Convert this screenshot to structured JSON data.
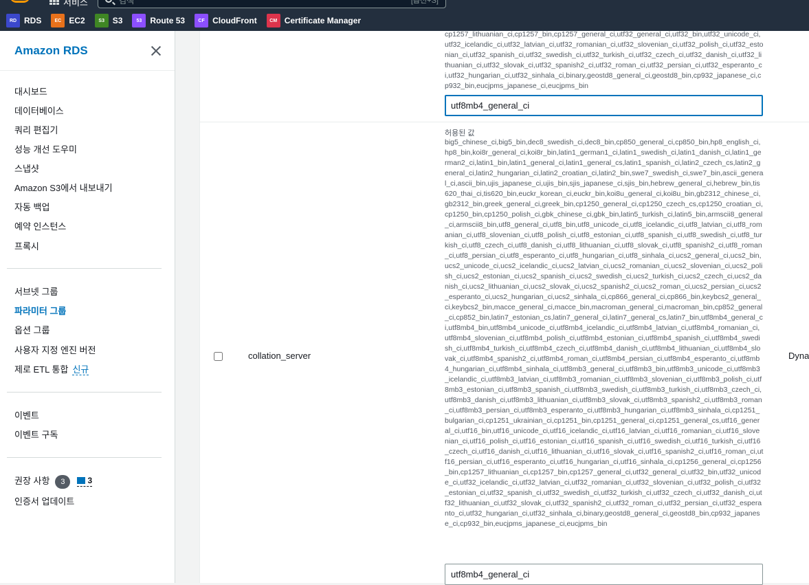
{
  "topbar": {
    "services_fragment": "서비스",
    "search": {
      "placeholder": "검색",
      "shortcut_hint": "[옵션+S]"
    },
    "favorites": [
      {
        "label": "RDS",
        "icon": "rds-icon",
        "color": "#3b48cc"
      },
      {
        "label": "EC2",
        "icon": "ec2-icon",
        "color": "#e7711b"
      },
      {
        "label": "S3",
        "icon": "s3-icon",
        "color": "#3f8624"
      },
      {
        "label": "Route 53",
        "icon": "route53-icon",
        "color": "#8c4fff"
      },
      {
        "label": "CloudFront",
        "icon": "cloudfront-icon",
        "color": "#8c4fff"
      },
      {
        "label": "Certificate Manager",
        "icon": "certificate-manager-icon",
        "color": "#dd344c"
      }
    ]
  },
  "sidebar": {
    "title": "Amazon RDS",
    "group1": [
      "대시보드",
      "데이터베이스",
      "쿼리 편집기",
      "성능 개선 도우미",
      "스냅샷",
      "Amazon S3에서 내보내기",
      "자동 백업",
      "예약 인스턴스",
      "프록시"
    ],
    "group2": [
      "서브넷 그룹",
      "파라미터 그룹",
      "옵션 그룹",
      "사용자 지정 엔진 버전"
    ],
    "zero_etl_label": "제로 ETL 통합",
    "zero_etl_badge": "신규",
    "group3": [
      "이벤트",
      "이벤트 구독"
    ],
    "recommendations_label": "권장 사항",
    "recommendations_count": "3",
    "recommendations_info_count": "3",
    "cert_update_label": "인증서 업데이트",
    "active_item": "파라미터 그룹"
  },
  "table": {
    "upper_row": {
      "allowed_values_tail": "cp1257_lithuanian_ci,cp1257_bin,cp1257_general_ci,utf32_general_ci,utf32_bin,utf32_unicode_ci,utf32_icelandic_ci,utf32_latvian_ci,utf32_romanian_ci,utf32_slovenian_ci,utf32_polish_ci,utf32_estonian_ci,utf32_spanish_ci,utf32_swedish_ci,utf32_turkish_ci,utf32_czech_ci,utf32_danish_ci,utf32_lithuanian_ci,utf32_slovak_ci,utf32_spanish2_ci,utf32_roman_ci,utf32_persian_ci,utf32_esperanto_ci,utf32_hungarian_ci,utf32_sinhala_ci,binary,geostd8_general_ci,geostd8_bin,cp932_japanese_ci,cp932_bin,eucjpms_japanese_ci,eucjpms_bin",
      "value": "utf8mb4_general_ci"
    },
    "row": {
      "name": "collation_server",
      "apply_type": "Dynamic",
      "allowed_label": "허용된 값",
      "allowed_values": "big5_chinese_ci,big5_bin,dec8_swedish_ci,dec8_bin,cp850_general_ci,cp850_bin,hp8_english_ci,hp8_bin,koi8r_general_ci,koi8r_bin,latin1_german1_ci,latin1_swedish_ci,latin1_danish_ci,latin1_german2_ci,latin1_bin,latin1_general_ci,latin1_general_cs,latin1_spanish_ci,latin2_czech_cs,latin2_general_ci,latin2_hungarian_ci,latin2_croatian_ci,latin2_bin,swe7_swedish_ci,swe7_bin,ascii_general_ci,ascii_bin,ujis_japanese_ci,ujis_bin,sjis_japanese_ci,sjis_bin,hebrew_general_ci,hebrew_bin,tis620_thai_ci,tis620_bin,euckr_korean_ci,euckr_bin,koi8u_general_ci,koi8u_bin,gb2312_chinese_ci,gb2312_bin,greek_general_ci,greek_bin,cp1250_general_ci,cp1250_czech_cs,cp1250_croatian_ci,cp1250_bin,cp1250_polish_ci,gbk_chinese_ci,gbk_bin,latin5_turkish_ci,latin5_bin,armscii8_general_ci,armscii8_bin,utf8_general_ci,utf8_bin,utf8_unicode_ci,utf8_icelandic_ci,utf8_latvian_ci,utf8_romanian_ci,utf8_slovenian_ci,utf8_polish_ci,utf8_estonian_ci,utf8_spanish_ci,utf8_swedish_ci,utf8_turkish_ci,utf8_czech_ci,utf8_danish_ci,utf8_lithuanian_ci,utf8_slovak_ci,utf8_spanish2_ci,utf8_roman_ci,utf8_persian_ci,utf8_esperanto_ci,utf8_hungarian_ci,utf8_sinhala_ci,ucs2_general_ci,ucs2_bin,ucs2_unicode_ci,ucs2_icelandic_ci,ucs2_latvian_ci,ucs2_romanian_ci,ucs2_slovenian_ci,ucs2_polish_ci,ucs2_estonian_ci,ucs2_spanish_ci,ucs2_swedish_ci,ucs2_turkish_ci,ucs2_czech_ci,ucs2_danish_ci,ucs2_lithuanian_ci,ucs2_slovak_ci,ucs2_spanish2_ci,ucs2_roman_ci,ucs2_persian_ci,ucs2_esperanto_ci,ucs2_hungarian_ci,ucs2_sinhala_ci,cp866_general_ci,cp866_bin,keybcs2_general_ci,keybcs2_bin,macce_general_ci,macce_bin,macroman_general_ci,macroman_bin,cp852_general_ci,cp852_bin,latin7_estonian_cs,latin7_general_ci,latin7_general_cs,latin7_bin,utf8mb4_general_ci,utf8mb4_bin,utf8mb4_unicode_ci,utf8mb4_icelandic_ci,utf8mb4_latvian_ci,utf8mb4_romanian_ci,utf8mb4_slovenian_ci,utf8mb4_polish_ci,utf8mb4_estonian_ci,utf8mb4_spanish_ci,utf8mb4_swedish_ci,utf8mb4_turkish_ci,utf8mb4_czech_ci,utf8mb4_danish_ci,utf8mb4_lithuanian_ci,utf8mb4_slovak_ci,utf8mb4_spanish2_ci,utf8mb4_roman_ci,utf8mb4_persian_ci,utf8mb4_esperanto_ci,utf8mb4_hungarian_ci,utf8mb4_sinhala_ci,utf8mb3_general_ci,utf8mb3_bin,utf8mb3_unicode_ci,utf8mb3_icelandic_ci,utf8mb3_latvian_ci,utf8mb3_romanian_ci,utf8mb3_slovenian_ci,utf8mb3_polish_ci,utf8mb3_estonian_ci,utf8mb3_spanish_ci,utf8mb3_swedish_ci,utf8mb3_turkish_ci,utf8mb3_czech_ci,utf8mb3_danish_ci,utf8mb3_lithuanian_ci,utf8mb3_slovak_ci,utf8mb3_spanish2_ci,utf8mb3_roman_ci,utf8mb3_persian_ci,utf8mb3_esperanto_ci,utf8mb3_hungarian_ci,utf8mb3_sinhala_ci,cp1251_bulgarian_ci,cp1251_ukrainian_ci,cp1251_bin,cp1251_general_ci,cp1251_general_cs,utf16_general_ci,utf16_bin,utf16_unicode_ci,utf16_icelandic_ci,utf16_latvian_ci,utf16_romanian_ci,utf16_slovenian_ci,utf16_polish_ci,utf16_estonian_ci,utf16_spanish_ci,utf16_swedish_ci,utf16_turkish_ci,utf16_czech_ci,utf16_danish_ci,utf16_lithuanian_ci,utf16_slovak_ci,utf16_spanish2_ci,utf16_roman_ci,utf16_persian_ci,utf16_esperanto_ci,utf16_hungarian_ci,utf16_sinhala_ci,cp1256_general_ci,cp1256_bin,cp1257_lithuanian_ci,cp1257_bin,cp1257_general_ci,utf32_general_ci,utf32_bin,utf32_unicode_ci,utf32_icelandic_ci,utf32_latvian_ci,utf32_romanian_ci,utf32_slovenian_ci,utf32_polish_ci,utf32_estonian_ci,utf32_spanish_ci,utf32_swedish_ci,utf32_turkish_ci,utf32_czech_ci,utf32_danish_ci,utf32_lithuanian_ci,utf32_slovak_ci,utf32_spanish2_ci,utf32_roman_ci,utf32_persian_ci,utf32_esperanto_ci,utf32_hungarian_ci,utf32_sinhala_ci,binary,geostd8_general_ci,geostd8_bin,cp932_japanese_ci,cp932_bin,eucjpms_japanese_ci,eucjpms_bin",
      "value": "utf8mb4_general_ci"
    }
  }
}
